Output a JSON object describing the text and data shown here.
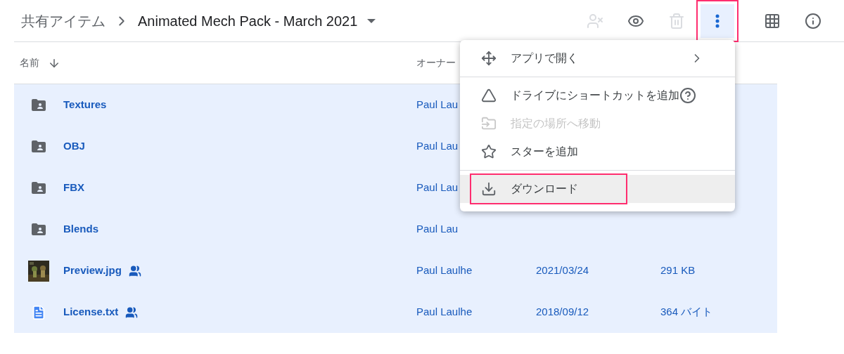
{
  "breadcrumb": {
    "parent": "共有アイテム",
    "current": "Animated Mech Pack - March 2021"
  },
  "toolbar": [
    {
      "kind": "share-off",
      "disabled": true,
      "selected": false
    },
    {
      "kind": "preview",
      "disabled": false,
      "selected": false
    },
    {
      "kind": "trash",
      "disabled": true,
      "selected": false
    },
    {
      "kind": "more",
      "disabled": false,
      "selected": true,
      "highlighted": true
    },
    {
      "kind": "grid",
      "disabled": false,
      "selected": false
    },
    {
      "kind": "info",
      "disabled": false,
      "selected": false
    }
  ],
  "table": {
    "columns": [
      {
        "label": "名前",
        "sorted": true
      },
      {
        "label": "オーナー"
      }
    ],
    "rows": [
      {
        "kind": "folder",
        "name": "Textures",
        "shared": false,
        "owner": "Paul Lau",
        "selected": true
      },
      {
        "kind": "folder",
        "name": "OBJ",
        "shared": false,
        "owner": "Paul Lau",
        "selected": true
      },
      {
        "kind": "folder",
        "name": "FBX",
        "shared": false,
        "owner": "Paul Lau",
        "selected": true
      },
      {
        "kind": "folder",
        "name": "Blends",
        "shared": false,
        "owner": "Paul Lau",
        "selected": true
      },
      {
        "kind": "picture",
        "name": "Preview.jpg",
        "shared": true,
        "owner": "Paul Laulhe",
        "modified": "2021/03/24",
        "size": "291 KB",
        "selected": true
      },
      {
        "kind": "document",
        "name": "License.txt",
        "shared": true,
        "owner": "Paul Laulhe",
        "modified": "2018/09/12",
        "size": "364 バイト",
        "selected": true
      }
    ]
  },
  "menu": {
    "groups": [
      [
        {
          "kind": "open-with",
          "label": "アプリで開く",
          "submenu": true,
          "help": false,
          "disabled": false,
          "highlighted": false
        }
      ],
      [
        {
          "kind": "shortcut",
          "label": "ドライブにショートカットを追加",
          "submenu": false,
          "help": true,
          "disabled": false,
          "highlighted": false
        },
        {
          "kind": "move",
          "label": "指定の場所へ移動",
          "submenu": false,
          "help": false,
          "disabled": true,
          "highlighted": false
        },
        {
          "kind": "star",
          "label": "スターを追加",
          "submenu": false,
          "help": false,
          "disabled": false,
          "highlighted": false
        }
      ],
      [
        {
          "kind": "download",
          "label": "ダウンロード",
          "submenu": false,
          "help": false,
          "disabled": false,
          "highlighted": true
        }
      ]
    ]
  }
}
